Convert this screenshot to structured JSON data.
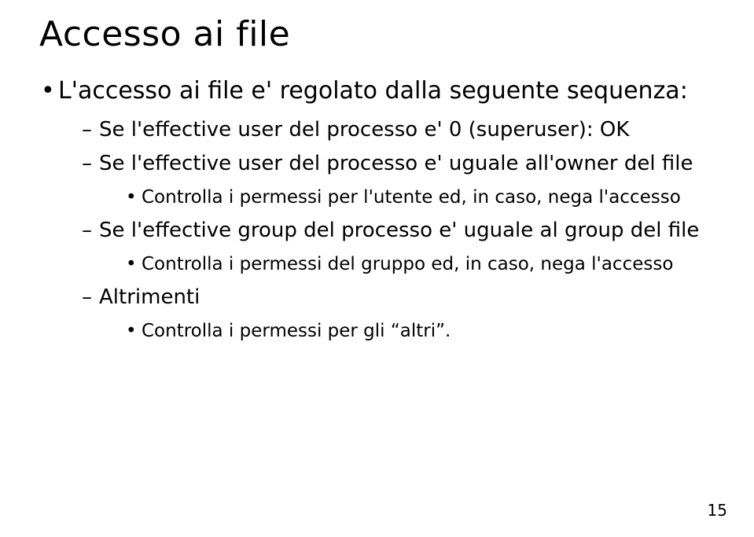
{
  "title": "Accesso ai file",
  "bullets": {
    "b1": "L'accesso ai file e' regolato dalla seguente sequenza:",
    "s1": "Se l'effective user del processo e' 0 (superuser): OK",
    "s2": "Se l'effective user del processo e' uguale all'owner del file",
    "s2a": "Controlla i permessi per l'utente ed, in caso, nega l'accesso",
    "s3": "Se l'effective group del processo e' uguale al group del file",
    "s3a": "Controlla i permessi del gruppo ed, in caso, nega l'accesso",
    "s4": "Altrimenti",
    "s4a": "Controlla i permessi per gli “altri”."
  },
  "page_number": "15"
}
